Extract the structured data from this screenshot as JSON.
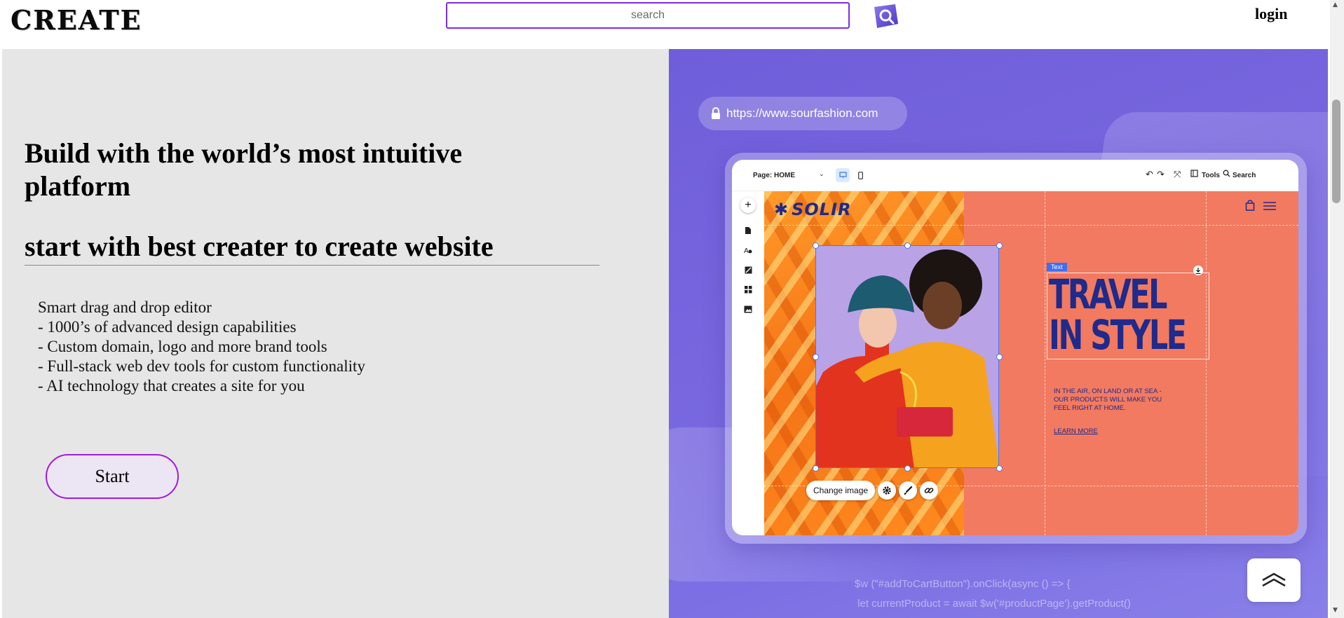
{
  "header": {
    "logo": "CREATE",
    "search_placeholder": "search",
    "login_label": "login"
  },
  "hero": {
    "headline": "Build with the world’s most intuitive platform",
    "subheadline": "start with best creater to create website",
    "features": [
      "Smart drag and drop editor",
      "- 1000’s of advanced design capabilities",
      "- Custom domain, logo and more brand tools",
      "- Full-stack web dev tools for custom functionality",
      "- AI technology that creates a site for you"
    ],
    "start_label": "Start"
  },
  "promo": {
    "url": "https://www.sourfashion.com",
    "editor": {
      "page_select": "Page: HOME",
      "tools_label": "Tools",
      "search_label": "Search"
    },
    "site": {
      "brand": "SOLIR",
      "text_tag": "Text",
      "headline": "TRAVEL\nIN STYLE",
      "tagline": "IN THE AIR, ON LAND OR AT SEA - OUR PRODUCTS WILL MAKE YOU FEEL RIGHT AT HOME.",
      "learn_more": "LEARN MORE",
      "change_image": "Change image"
    },
    "code_lines": [
      "$w (\"#addToCartButton\").onClick(async () => {",
      " let currentProduct = await $w('#productPage').getProduct()"
    ]
  },
  "colors": {
    "accent": "#7a2cf0",
    "start_border": "#a219e0",
    "promo_bg": "#7466de",
    "site_coral": "#f27a60",
    "site_navy": "#1e2a8c"
  },
  "icons": [
    "search-icon",
    "lock-icon",
    "chevron-up-double-icon",
    "cart-icon",
    "menu-icon",
    "gear-icon",
    "brush-icon",
    "link-icon"
  ]
}
